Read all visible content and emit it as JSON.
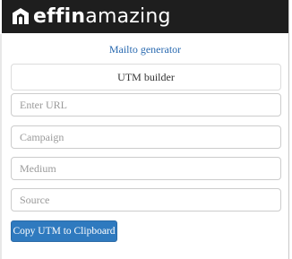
{
  "header": {
    "brand_bold": "effin",
    "brand_light": "amazing",
    "logo_icon": "effinamazing-logo-icon"
  },
  "nav": {
    "mailto_link": "Mailto generator"
  },
  "utm_builder": {
    "title": "UTM builder",
    "fields": {
      "url": {
        "value": "",
        "placeholder": "Enter URL"
      },
      "campaign": {
        "value": "",
        "placeholder": "Campaign"
      },
      "medium": {
        "value": "",
        "placeholder": "Medium"
      },
      "source": {
        "value": "",
        "placeholder": "Source"
      }
    },
    "copy_button": "Copy UTM to Clipboard"
  },
  "colors": {
    "header_bg": "#1e1e1e",
    "link": "#2a6ab0",
    "button_bg": "#2f7abf"
  }
}
